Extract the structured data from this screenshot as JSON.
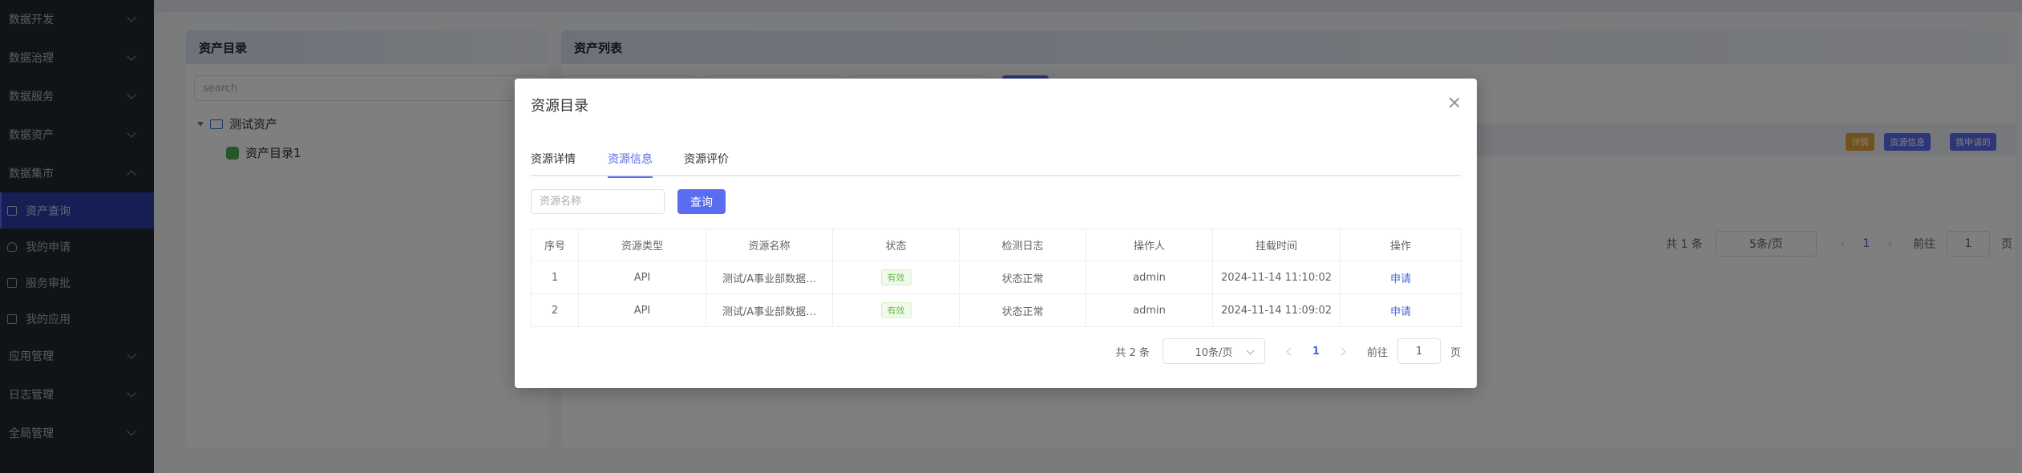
{
  "sidebar": {
    "groups_top": [
      {
        "label": "数据开发"
      },
      {
        "label": "数据治理"
      },
      {
        "label": "数据服务"
      },
      {
        "label": "数据资产"
      },
      {
        "label": "数据集市"
      }
    ],
    "sub_items": [
      {
        "label": "资产查询",
        "icon": "doc-icon",
        "active": true
      },
      {
        "label": "我的申请",
        "icon": "user-icon",
        "active": false
      },
      {
        "label": "服务审批",
        "icon": "file-icon",
        "active": false
      },
      {
        "label": "我的应用",
        "icon": "grid-icon",
        "active": false
      }
    ],
    "groups_bottom": [
      {
        "label": "应用管理"
      },
      {
        "label": "日志管理"
      },
      {
        "label": "全局管理"
      }
    ]
  },
  "background": {
    "left_panel_title": "资产目录",
    "left_search_placeholder": "search",
    "tree_root": "测试资产",
    "tree_child": "资产目录1",
    "right_panel_title": "资产列表",
    "buttons": {
      "detail": "详情",
      "resource_info": "资源信息",
      "my_applied": "我申请的"
    },
    "pager": {
      "total": "共 1 条",
      "page_size": "5条/页",
      "current": "1",
      "goto": "前往",
      "goto_value": "1",
      "page_unit": "页"
    }
  },
  "dialog": {
    "title": "资源目录",
    "tabs": [
      {
        "label": "资源详情",
        "active": false
      },
      {
        "label": "资源信息",
        "active": true
      },
      {
        "label": "资源评价",
        "active": false
      }
    ],
    "query": {
      "placeholder": "资源名称",
      "button": "查询"
    },
    "table": {
      "headers": [
        "序号",
        "资源类型",
        "资源名称",
        "状态",
        "检测日志",
        "操作人",
        "挂载时间",
        "操作"
      ],
      "rows": [
        {
          "index": "1",
          "type": "API",
          "name": "测试/A事业部数据…",
          "status": "有效",
          "log": "状态正常",
          "operator": "admin",
          "mount_time": "2024-11-14 11:10:02",
          "action": "申请"
        },
        {
          "index": "2",
          "type": "API",
          "name": "测试/A事业部数据…",
          "status": "有效",
          "log": "状态正常",
          "operator": "admin",
          "mount_time": "2024-11-14 11:09:02",
          "action": "申请"
        }
      ]
    },
    "pager": {
      "total": "共 2 条",
      "page_size": "10条/页",
      "current": "1",
      "goto": "前往",
      "goto_value": "1",
      "page_unit": "页"
    }
  },
  "colors": {
    "primary": "#5a6cf0",
    "sidebar_bg": "#20262f",
    "active_menu": "#2d3ea8",
    "success": "#67c23a",
    "warning_btn": "#e6a23c"
  }
}
